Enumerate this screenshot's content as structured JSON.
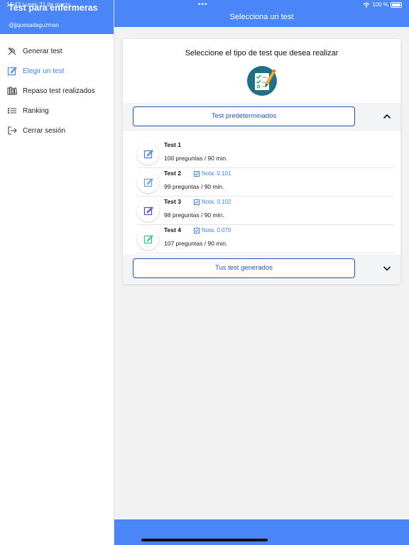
{
  "statusbar": {
    "time": "16:43  Lunes 31 de marzo",
    "dots": "•••",
    "battery": "100 %"
  },
  "sidebar": {
    "app_title": "Test para enfermeras",
    "username": "@jjquesadaguzman",
    "items": [
      {
        "label": "Generar test",
        "icon": "tools-icon",
        "active": false
      },
      {
        "label": "Elegir un test",
        "icon": "edit-icon",
        "active": true
      },
      {
        "label": "Repaso test realizados",
        "icon": "library-icon",
        "active": false
      },
      {
        "label": "Ranking",
        "icon": "list-icon",
        "active": false
      },
      {
        "label": "Cerrar sesión",
        "icon": "logout-icon",
        "active": false
      }
    ]
  },
  "header": {
    "title": "Selecciona un test"
  },
  "card": {
    "heading": "Seleccione el tipo de test que desea realizar",
    "sections": [
      {
        "label": "Test predeterminados",
        "expanded": true
      },
      {
        "label": "Tus test generados",
        "expanded": false
      }
    ],
    "tests": [
      {
        "name": "Test 1",
        "nota": "",
        "meta": "100 preguntas / 90 min.",
        "icon_color": "#3b82f6"
      },
      {
        "name": "Test 2",
        "nota": "Nota: 0.101",
        "meta": "99 preguntas / 90 min.",
        "icon_color": "#60a5fa"
      },
      {
        "name": "Test 3",
        "nota": "Nota: 0.102",
        "meta": "98 preguntas / 90 min.",
        "icon_color": "#4f46e5"
      },
      {
        "name": "Test 4",
        "nota": "Nota: 0.070",
        "meta": "107 preguntas / 90 min.",
        "icon_color": "#34c77b"
      }
    ]
  },
  "colors": {
    "accent": "#4a86f7",
    "button_border": "#1f56b5",
    "link": "#3b82f6"
  }
}
